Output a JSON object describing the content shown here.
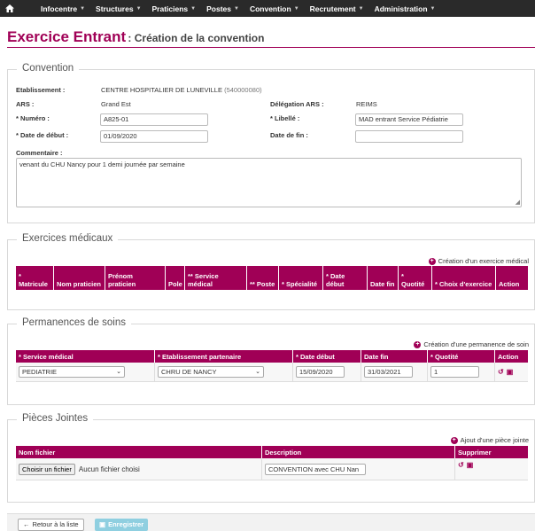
{
  "nav": {
    "home_icon": "home-icon",
    "items": [
      {
        "label": "Infocentre"
      },
      {
        "label": "Structures"
      },
      {
        "label": "Praticiens"
      },
      {
        "label": "Postes"
      },
      {
        "label": "Convention"
      },
      {
        "label": "Recrutement"
      },
      {
        "label": "Administration"
      }
    ]
  },
  "page": {
    "title": "Exercice Entrant",
    "subtitle": ": Création de la convention"
  },
  "convention": {
    "legend": "Convention",
    "etablissement_label": "Etablissement :",
    "etablissement_value": "CENTRE HOSPITALIER DE LUNEVILLE",
    "etablissement_code": "(540000080)",
    "ars_label": "ARS :",
    "ars_value": "Grand Est",
    "delegation_label": "Délégation ARS :",
    "delegation_value": "REIMS",
    "numero_label": "* Numéro :",
    "numero_value": "A825-01",
    "libelle_label": "* Libellé :",
    "libelle_value": "MAD entrant Service Pédiatrie",
    "date_debut_label": "* Date de début :",
    "date_debut_value": "01/09/2020",
    "date_fin_label": "Date de fin :",
    "date_fin_value": "",
    "commentaire_label": "Commentaire :",
    "commentaire_value": "venant du CHU Nancy pour 1 demi journée par semaine"
  },
  "exercices": {
    "legend": "Exercices médicaux",
    "add_link": "Création d'un exercice médical",
    "columns": [
      "* Matricule",
      "Nom praticien",
      "Prénom praticien",
      "Pole",
      "** Service médical",
      "** Poste",
      "* Spécialité",
      "* Date début",
      "Date fin",
      "* Quotité",
      "* Choix d'exercice",
      "Action"
    ]
  },
  "permanences": {
    "legend": "Permanences de soins",
    "add_link": "Création d'une permanence de soin",
    "columns": [
      "* Service médical",
      "* Etablissement partenaire",
      "* Date début",
      "Date fin",
      "* Quotité",
      "Action"
    ],
    "row": {
      "service": "PEDIATRIE",
      "etablissement": "CHRU DE NANCY",
      "date_debut": "15/09/2020",
      "date_fin": "31/03/2021",
      "quotite": "1"
    }
  },
  "pieces": {
    "legend": "Pièces Jointes",
    "add_link": "Ajout d'une pièce jointe",
    "columns": [
      "Nom fichier",
      "Description",
      "Supprimer"
    ],
    "row": {
      "file_button": "Choisir un fichier",
      "file_status": "Aucun fichier choisi",
      "description": "CONVENTION avec CHU Nan"
    }
  },
  "footer": {
    "back_label": "Retour à la liste",
    "save_label": "Enregistrer"
  }
}
